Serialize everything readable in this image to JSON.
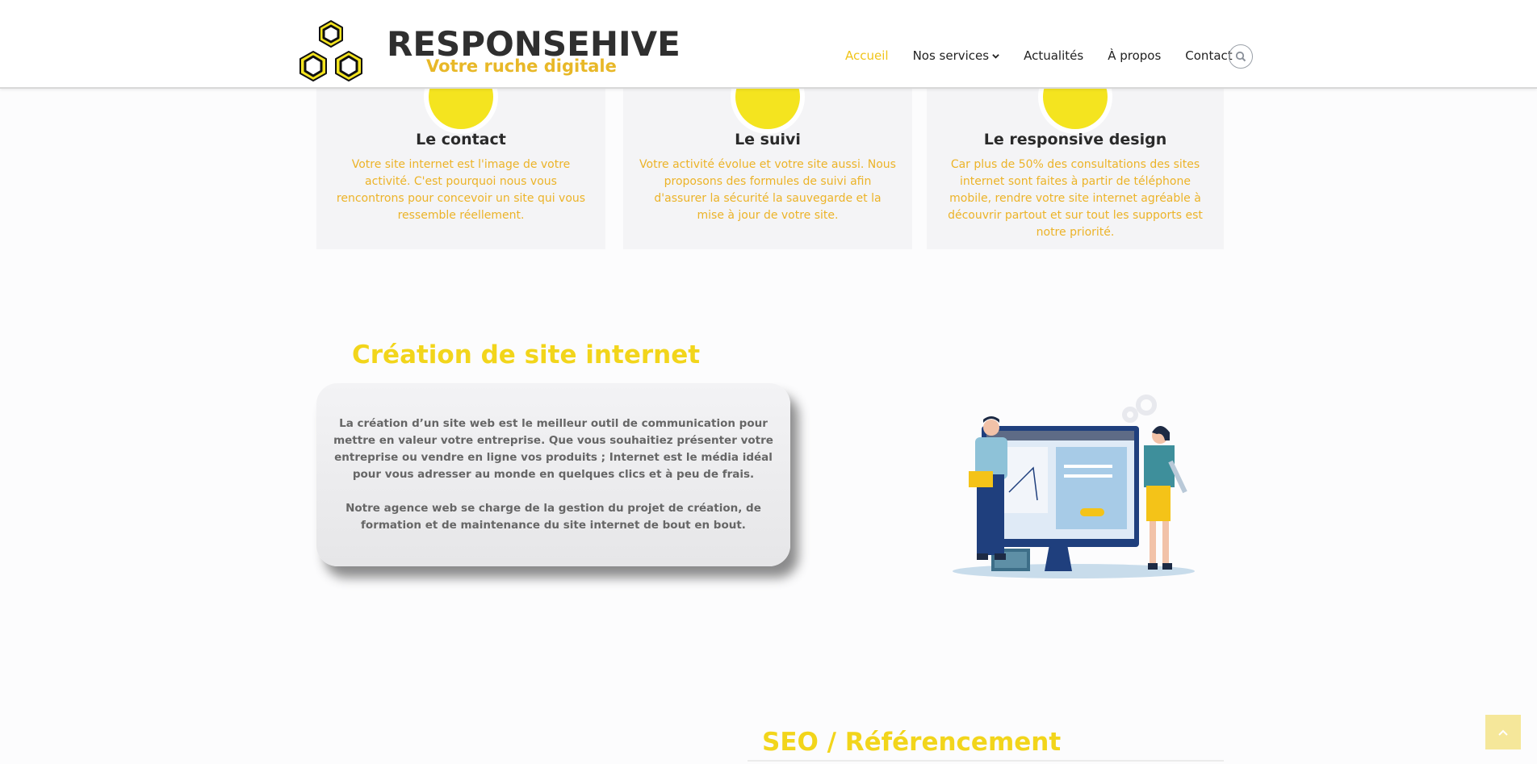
{
  "header": {
    "brand_name": "RESPONSEHIVE",
    "brand_tagline": "Votre ruche digitale",
    "nav": [
      {
        "label": "Accueil",
        "active": true
      },
      {
        "label": "Nos services",
        "dropdown": true
      },
      {
        "label": "Actualités"
      },
      {
        "label": "À propos"
      },
      {
        "label": "Contact"
      }
    ],
    "search_icon": "search-icon"
  },
  "features": [
    {
      "title": "Le contact",
      "text": "Votre site internet est l'image de votre activité. C'est pourquoi nous vous rencontrons pour concevoir un site qui vous ressemble réellement."
    },
    {
      "title": "Le suivi",
      "text": "Votre activité évolue et votre site aussi. Nous proposons des formules de suivi afin d'assurer la sécurité la sauvegarde et la mise à jour de votre site."
    },
    {
      "title": "Le responsive design",
      "text": "Car plus de 50% des consultations des sites internet sont faites à partir de téléphone mobile, rendre votre site internet agréable à découvrir partout et sur tout les supports est notre priorité."
    }
  ],
  "creation": {
    "title": "Création de site internet",
    "paragraphs": [
      "La création d’un site web est le meilleur outil de communication pour mettre en valeur votre entreprise. Que vous souhaitiez présenter votre entreprise ou vendre en ligne vos produits ; Internet est le média idéal pour vous adresser au monde en quelques clics et à peu de frais.",
      "Notre agence web se charge de la gestion du projet de création, de formation et de maintenance du site internet de bout en bout."
    ]
  },
  "seo": {
    "title": "SEO / Référencement"
  },
  "colors": {
    "accent_yellow": "#f2d51b",
    "tagline_gold": "#e8b828",
    "card_bg": "#f4f4f6",
    "back_to_top_bg": "#f5e79a"
  }
}
